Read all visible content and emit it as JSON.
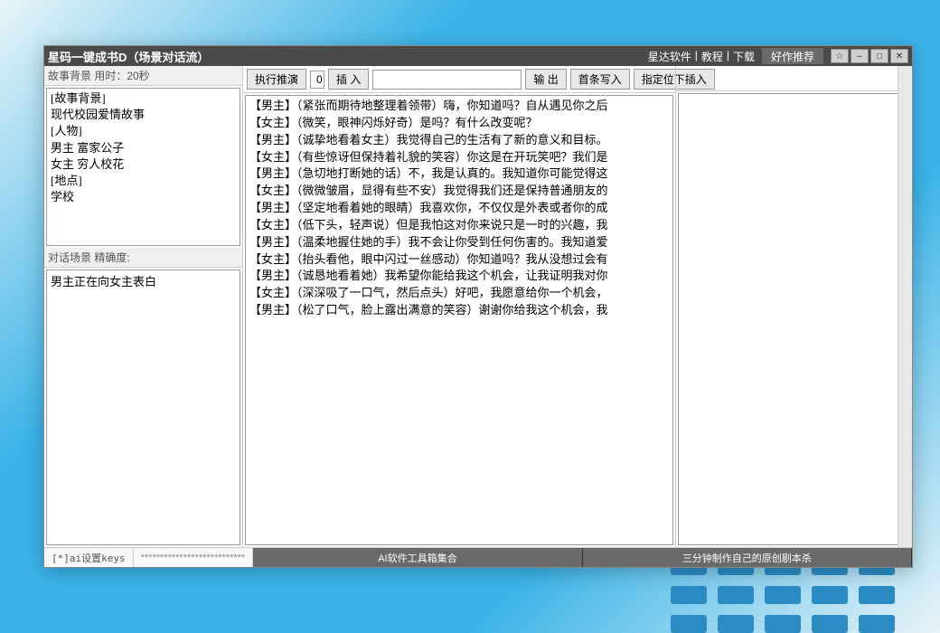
{
  "titlebar": {
    "title": "星码一键成书D（场景对话流）",
    "links": [
      "星达软件",
      "教程",
      "下载"
    ],
    "recommend": "好作推荐",
    "controls": {
      "star": "☆",
      "minimize": "–",
      "maximize": "□",
      "close": "✕"
    }
  },
  "left": {
    "story_header": "故事背景  用时：20秒",
    "story_text": "[故事背景]\n现代校园爱情故事\n[人物]\n男主 富家公子\n女主 穷人校花\n[地点]\n学校",
    "dialogue_header": "对话场景  精确度:",
    "dialogue_text": "男主正在向女主表白"
  },
  "toolbar": {
    "execute": "执行推演",
    "counter": "0",
    "insert": "插 入",
    "output": "输 出",
    "first_write": "首条写入",
    "insert_below": "指定位下插入"
  },
  "dialogue_lines": [
    {
      "role": "【男主】",
      "text": "（紧张而期待地整理着领带）嗨，你知道吗？自从遇见你之后"
    },
    {
      "role": "【女主】",
      "text": "（微笑，眼神闪烁好奇）是吗？有什么改变呢？"
    },
    {
      "role": "【男主】",
      "text": "（诚挚地看着女主）我觉得自己的生活有了新的意义和目标。"
    },
    {
      "role": "【女主】",
      "text": "（有些惊讶但保持着礼貌的笑容）你这是在开玩笑吧？我们是"
    },
    {
      "role": "【男主】",
      "text": "（急切地打断她的话）不，我是认真的。我知道你可能觉得这"
    },
    {
      "role": "【女主】",
      "text": "（微微皱眉，显得有些不安）我觉得我们还是保持普通朋友的"
    },
    {
      "role": "【男主】",
      "text": "（坚定地看着她的眼睛）我喜欢你，不仅仅是外表或者你的成"
    },
    {
      "role": "【女主】",
      "text": "（低下头，轻声说）但是我怕这对你来说只是一时的兴趣，我"
    },
    {
      "role": "【男主】",
      "text": "（温柔地握住她的手）我不会让你受到任何伤害的。我知道爱"
    },
    {
      "role": "【女主】",
      "text": "（抬头看他，眼中闪过一丝感动）你知道吗？我从没想过会有"
    },
    {
      "role": "【男主】",
      "text": "（诚恳地看着她）我希望你能给我这个机会，让我证明我对你"
    },
    {
      "role": "【女主】",
      "text": "（深深吸了一口气，然后点头）好吧，我愿意给你一个机会，"
    },
    {
      "role": "【男主】",
      "text": "（松了口气，脸上露出满意的笑容）谢谢你给我这个机会，我"
    }
  ],
  "bottom": {
    "keys": "[*]ai设置keys",
    "stars": "***************************",
    "toolbox": "AI软件工具箱集合",
    "script": "三分钟制作自己的原创剧本杀"
  }
}
